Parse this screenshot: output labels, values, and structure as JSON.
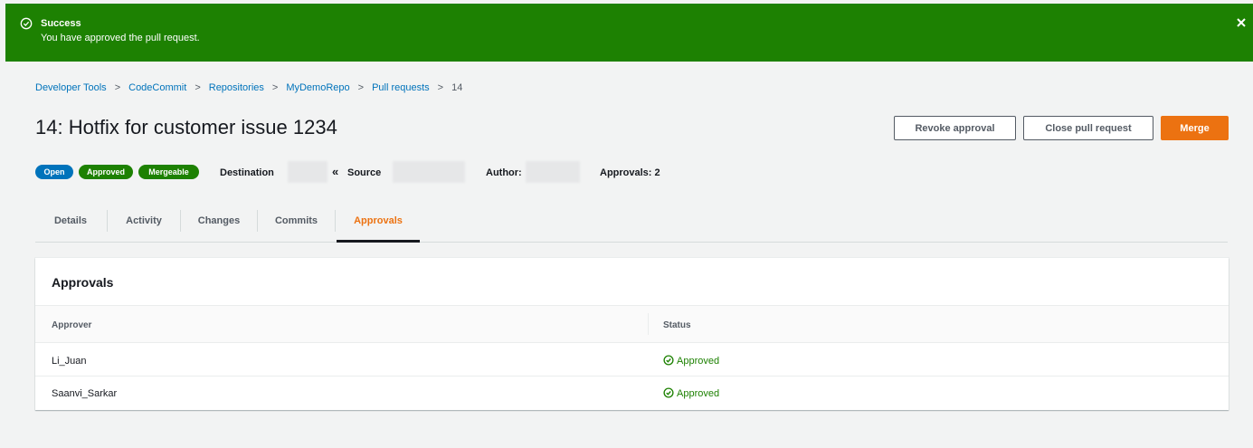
{
  "flash": {
    "title": "Success",
    "message": "You have approved the pull request.",
    "icon": "check-circle-icon",
    "close_icon": "close-icon",
    "color": "#1d8102"
  },
  "breadcrumb": {
    "items": [
      "Developer Tools",
      "CodeCommit",
      "Repositories",
      "MyDemoRepo",
      "Pull requests",
      "14"
    ]
  },
  "page": {
    "title": "14: Hotfix for customer issue 1234"
  },
  "actions": {
    "revoke_label": "Revoke approval",
    "close_label": "Close pull request",
    "merge_label": "Merge",
    "merge_color": "#ec7211"
  },
  "meta": {
    "badges": [
      "Open",
      "Approved",
      "Mergeable"
    ],
    "destination_label": "Destination",
    "source_label": "Source",
    "author_label": "Author:",
    "approvals_label": "Approvals: 2"
  },
  "tabs": [
    {
      "label": "Details"
    },
    {
      "label": "Activity"
    },
    {
      "label": "Changes"
    },
    {
      "label": "Commits"
    },
    {
      "label": "Approvals"
    }
  ],
  "approvals": {
    "title": "Approvals",
    "columns": [
      "Approver",
      "Status"
    ],
    "rows": [
      {
        "approver": "Li_Juan",
        "status": "Approved"
      },
      {
        "approver": "Saanvi_Sarkar",
        "status": "Approved"
      }
    ]
  }
}
